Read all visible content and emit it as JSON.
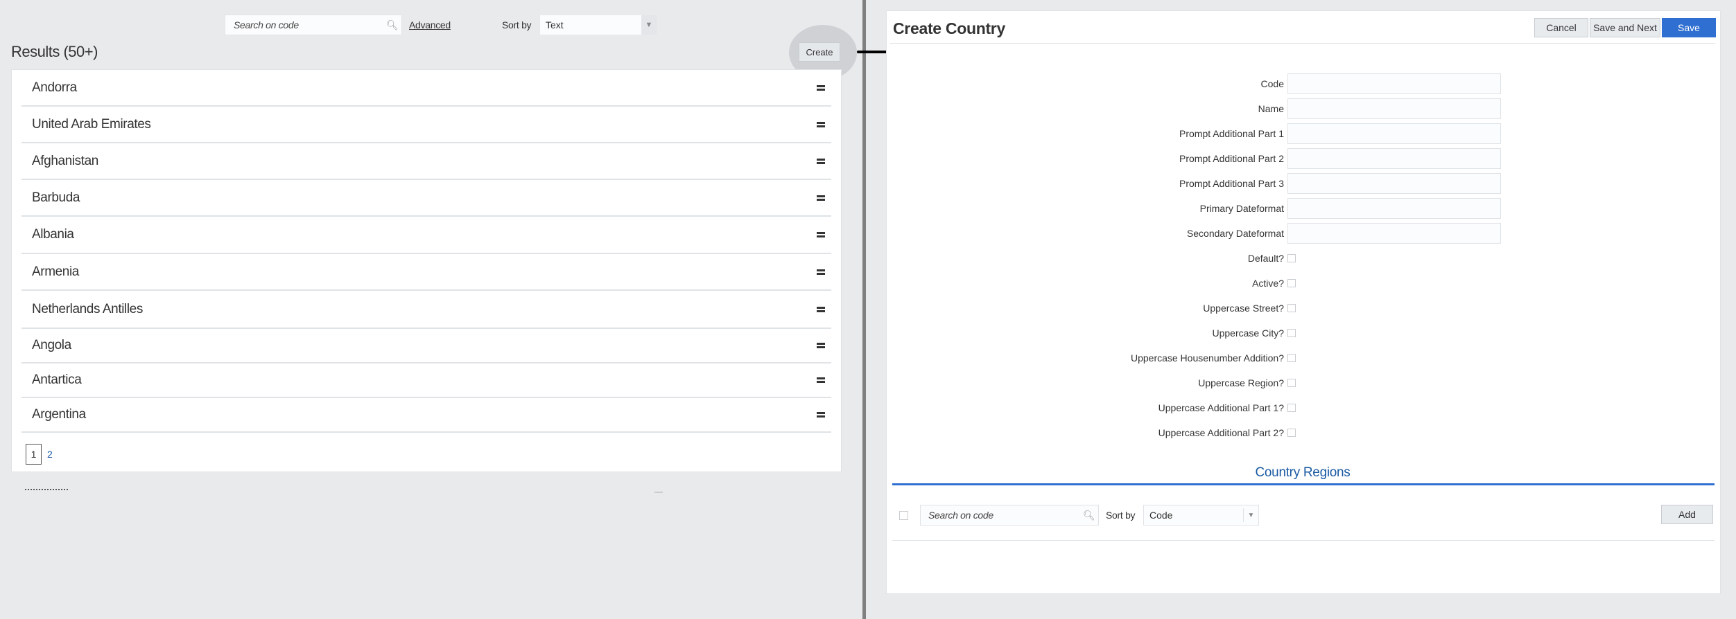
{
  "list_view": {
    "search": {
      "placeholder": "Search on code",
      "icon": "search-icon"
    },
    "advanced_label": "Advanced",
    "sort_by_label": "Sort by",
    "sort_by_value": "Text",
    "results_title": "Results (50+)",
    "create_label": "Create",
    "rows": [
      {
        "name": "Andorra"
      },
      {
        "name": "United Arab Emirates"
      },
      {
        "name": "Afghanistan"
      },
      {
        "name": "Barbuda"
      },
      {
        "name": "Albania"
      },
      {
        "name": "Armenia"
      },
      {
        "name": "Netherlands Antilles"
      },
      {
        "name": "Angola"
      },
      {
        "name": "Antartica"
      },
      {
        "name": "Argentina"
      }
    ],
    "pagination": {
      "current": "1",
      "pages": [
        "1",
        "2"
      ]
    }
  },
  "create_dialog": {
    "title": "Create Country",
    "buttons": {
      "cancel": "Cancel",
      "save_and_next": "Save and Next",
      "save": "Save"
    },
    "text_fields": [
      {
        "label": "Code",
        "value": ""
      },
      {
        "label": "Name",
        "value": ""
      },
      {
        "label": "Prompt Additional Part 1",
        "value": ""
      },
      {
        "label": "Prompt Additional Part 2",
        "value": ""
      },
      {
        "label": "Prompt Additional Part 3",
        "value": ""
      },
      {
        "label": "Primary Dateformat",
        "value": ""
      },
      {
        "label": "Secondary Dateformat",
        "value": ""
      }
    ],
    "checkboxes": [
      {
        "label": "Default?",
        "checked": false
      },
      {
        "label": "Active?",
        "checked": false
      },
      {
        "label": "Uppercase Street?",
        "checked": false
      },
      {
        "label": "Uppercase City?",
        "checked": false
      },
      {
        "label": "Uppercase Housenumber Addition?",
        "checked": false
      },
      {
        "label": "Uppercase Region?",
        "checked": false
      },
      {
        "label": "Uppercase Additional Part 1?",
        "checked": false
      },
      {
        "label": "Uppercase Additional Part 2?",
        "checked": false
      }
    ],
    "regions": {
      "title": "Country Regions",
      "search_placeholder": "Search on code",
      "sort_by_label": "Sort by",
      "sort_by_value": "Code",
      "add_label": "Add"
    }
  },
  "colors": {
    "background": "#e9eaec",
    "primary": "#2e6fd1",
    "link": "#1a5aa3",
    "divider": "#7f7f7f"
  }
}
